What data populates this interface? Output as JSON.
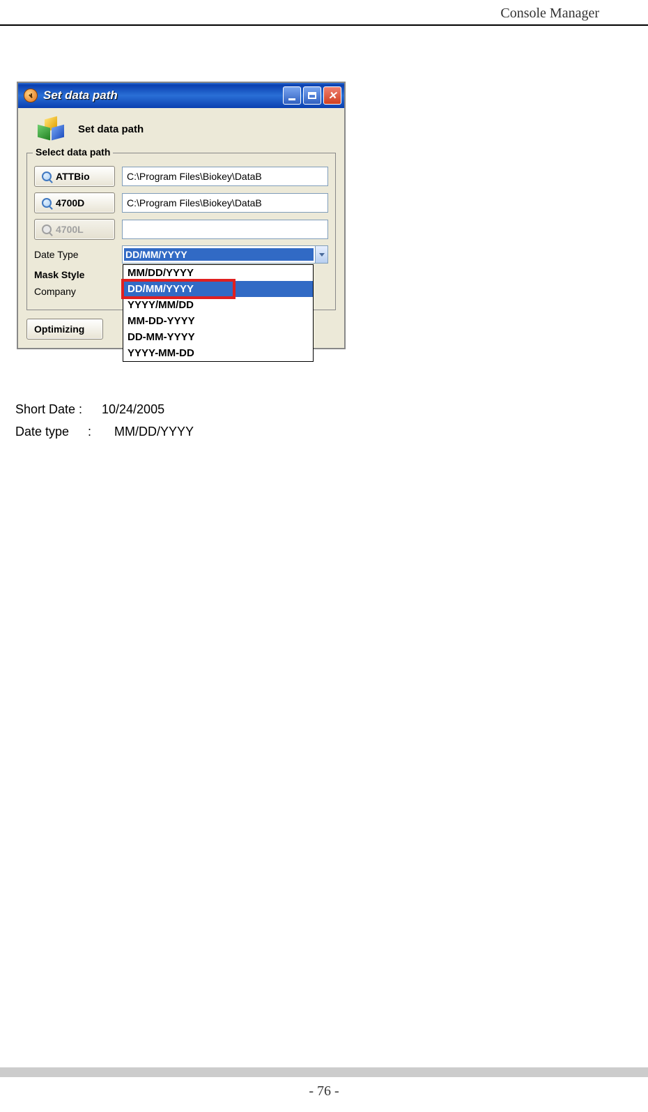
{
  "header": {
    "title": "Console Manager"
  },
  "footer": {
    "page_number": "- 76 -"
  },
  "window": {
    "title": "Set data path",
    "header_label": "Set data path",
    "fieldset_title": "Select data path",
    "rows": {
      "attbio_btn": "ATTBio",
      "attbio_path": "C:\\Program Files\\Biokey\\DataB",
      "d4700_btn": "4700D",
      "d4700_path": "C:\\Program Files\\Biokey\\DataB",
      "l4700_btn": "4700L",
      "l4700_path": "",
      "date_type_label": "Date Type",
      "mask_style_label": "Mask Style",
      "company_label": "Company"
    },
    "combo": {
      "selected": "DD/MM/YYYY",
      "options": [
        "MM/DD/YYYY",
        "DD/MM/YYYY",
        "YYYY/MM/DD",
        "MM-DD-YYYY",
        "DD-MM-YYYY",
        "YYYY-MM-DD"
      ]
    },
    "optimizing_btn": "Optimizing"
  },
  "body_text": {
    "short_date_label": "Short Date :",
    "short_date_value": "10/24/2005",
    "date_type_label": "Date type",
    "date_type_colon": ":",
    "date_type_value": "MM/DD/YYYY"
  }
}
